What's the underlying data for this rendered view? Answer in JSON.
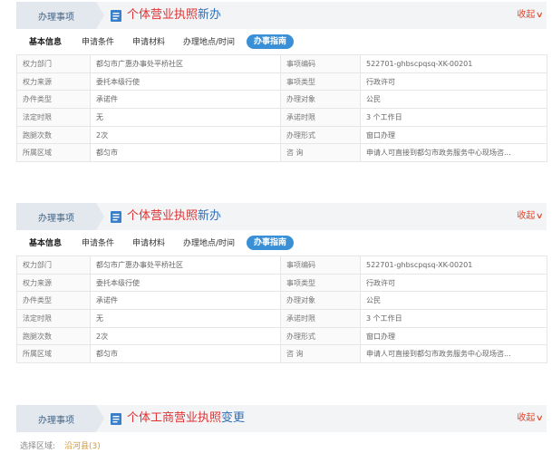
{
  "items": [
    {
      "tag": "办理事项",
      "title_red": "个体营业执照",
      "title_blue": "新办",
      "collapse": "收起",
      "tabs": [
        "基本信息",
        "申请条件",
        "申请材料",
        "办理地点/时间",
        "办事指南"
      ],
      "rows": [
        [
          "权力部门",
          "都匀市广惠办事处平桥社区",
          "事项编码",
          "522701-ghbscpqsq-XK-00201"
        ],
        [
          "权力来源",
          "委托本级行使",
          "事项类型",
          "行政许可"
        ],
        [
          "办件类型",
          "承诺件",
          "办理对象",
          "公民"
        ],
        [
          "法定时限",
          "无",
          "承诺时限",
          "3 个工作日"
        ],
        [
          "跑腿次数",
          "2次",
          "办理形式",
          "窗口办理"
        ],
        [
          "所属区域",
          "都匀市",
          "咨 询",
          "申请人可直接到都匀市政务服务中心现场咨..."
        ]
      ]
    },
    {
      "tag": "办理事项",
      "title_red": "个体营业执照",
      "title_blue": "新办",
      "collapse": "收起",
      "tabs": [
        "基本信息",
        "申请条件",
        "申请材料",
        "办理地点/时间",
        "办事指南"
      ],
      "rows": [
        [
          "权力部门",
          "都匀市广惠办事处平桥社区",
          "事项编码",
          "522701-ghbscpqsq-XK-00201"
        ],
        [
          "权力来源",
          "委托本级行使",
          "事项类型",
          "行政许可"
        ],
        [
          "办件类型",
          "承诺件",
          "办理对象",
          "公民"
        ],
        [
          "法定时限",
          "无",
          "承诺时限",
          "3 个工作日"
        ],
        [
          "跑腿次数",
          "2次",
          "办理形式",
          "窗口办理"
        ],
        [
          "所属区域",
          "都匀市",
          "咨 询",
          "申请人可直接到都匀市政务服务中心现场咨..."
        ]
      ]
    },
    {
      "tag": "办理事项",
      "title_red": "个体工商营业执照",
      "title_blue": "变更",
      "collapse": "收起"
    }
  ],
  "region": {
    "label": "选择区域:",
    "value": "沿河县(3)"
  },
  "icons": {
    "doc": "document-icon",
    "collapse": "chevron-down-icon"
  },
  "colors": {
    "title_red": "#e13232",
    "title_blue": "#2f6fb8",
    "collapse": "#e0452a",
    "tab_active": "#3a90d6"
  }
}
